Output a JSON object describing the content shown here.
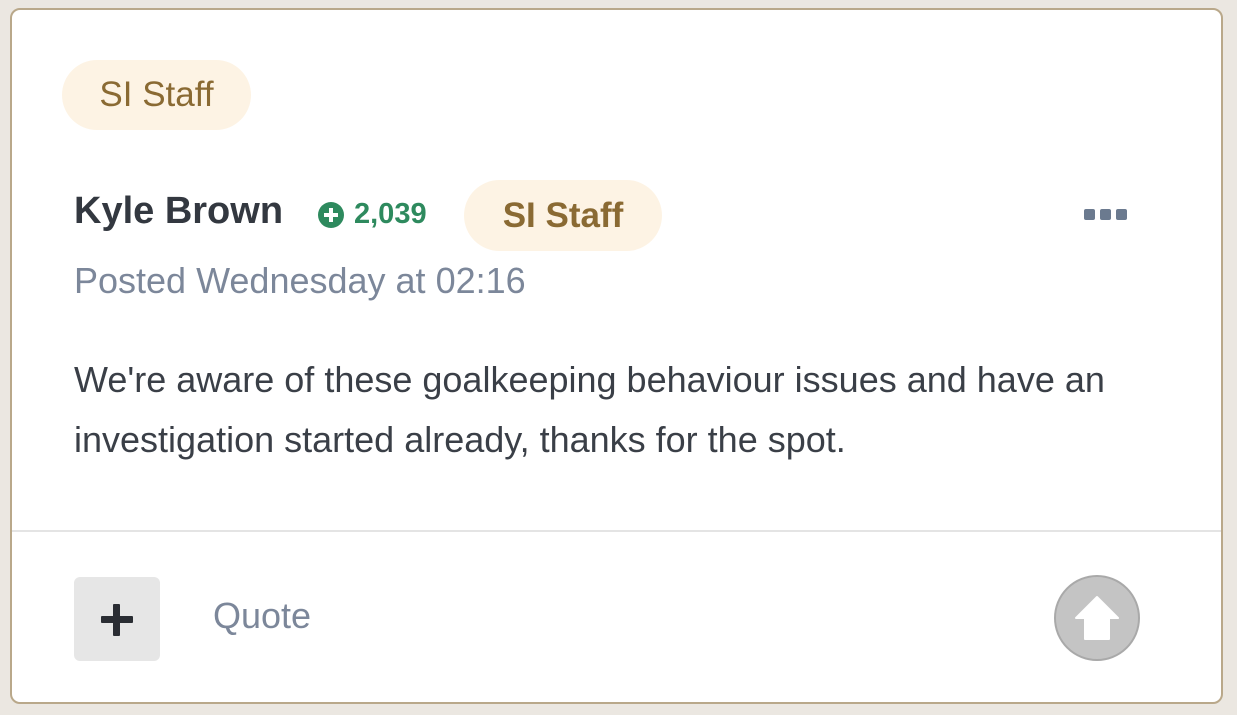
{
  "top_badge": "SI Staff",
  "post": {
    "author": {
      "name": "Kyle Brown",
      "reputation": "2,039",
      "badge": "SI Staff"
    },
    "posted": "Posted Wednesday at 02:16",
    "body": "We're aware of these goalkeeping behaviour issues and have an investigation started already, thanks for the spot."
  },
  "footer": {
    "quote_label": "Quote"
  },
  "icons": {
    "reputation": "plus-circle-icon",
    "more": "more-dots-icon",
    "add": "plus-icon",
    "upvote": "arrow-up-icon"
  },
  "colors": {
    "badge_bg": "#fdf3e4",
    "badge_text": "#8a6a33",
    "reputation": "#2e8a5e",
    "meta_text": "#7c879a",
    "border": "#b9a88a"
  }
}
